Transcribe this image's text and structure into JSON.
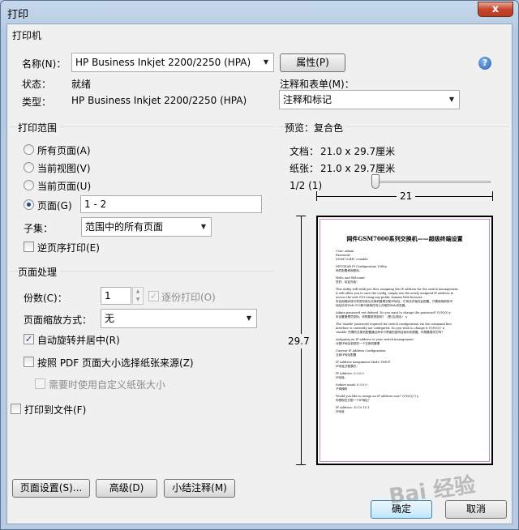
{
  "window": {
    "title": "打印",
    "close_label": "x"
  },
  "printer": {
    "section_title": "打印机",
    "name_label": "名称(N)：",
    "name_value": "HP Business Inkjet 2200/2250 (HPA)",
    "properties_button": "属性(P)",
    "status_label": "状态：",
    "status_value": "就绪",
    "type_label": "类型：",
    "type_value": "HP Business Inkjet 2200/2250 (HPA)",
    "comments_label": "注释和表单(M)：",
    "comments_value": "注释和标记",
    "help_icon": "?"
  },
  "print_range": {
    "section_title": "打印范围",
    "options": [
      {
        "label": "所有页面(A)",
        "selected": false
      },
      {
        "label": "当前视图(V)",
        "selected": false
      },
      {
        "label": "当前页面(U)",
        "selected": false
      },
      {
        "label": "页面(G)",
        "selected": true
      }
    ],
    "pages_value": "1 - 2",
    "subset_label": "子集：",
    "subset_value": "范围中的所有页面",
    "reverse_label": "逆页序打印(E)",
    "reverse_checked": false
  },
  "page_handling": {
    "section_title": "页面处理",
    "copies_label": "份数(C)：",
    "copies_value": "1",
    "collate_label": "逐份打印(O)",
    "collate_checked": true,
    "scaling_label": "页面缩放方式：",
    "scaling_value": "无",
    "auto_rotate_label": "自动旋转并居中(R)",
    "auto_rotate_checked": true,
    "pdf_paper_label": "按照 PDF 页面大小选择纸张来源(Z)",
    "pdf_paper_checked": false,
    "custom_paper_label": "需要时使用自定义纸张大小",
    "custom_paper_checked": false
  },
  "print_to_file_label": "打印到文件(F)",
  "print_to_file_checked": false,
  "preview": {
    "section_title": "预览：复合色",
    "document_label": "文档：",
    "document_size": "21.0 x 29.7厘米",
    "paper_label": "纸张：",
    "paper_size": "21.0 x 29.7厘米",
    "page_counter": "1/2 (1)",
    "slider_value": 0.0,
    "width_dim": "21",
    "height_dim": "29.7",
    "doc_title": "网件GSM7000系列交换机——超级终端设置",
    "doc_lines": [
      "User: admin",
      "Password:",
      "(GSM7224P) >enable",
      "",
      "NETGEAR FI Configuration Utility",
      "网件配置使用程序。",
      "",
      "Hello and Welcome!",
      "您好，欢迎光临！",
      "",
      "This utility will walk you thru assigning the IP address for the switch management.",
      "It will allow you to save the config, simply use the newly assigned IP address to",
      "access the web GUI using any public domain Web browser.",
      "本实用程序将引导您完成为交换机管理分配IP地址，它将允许保存此配置。只需使用新的IP",
      "地址访问Web GUI即可使用任何公共域的Web浏览器。",
      "",
      "Admin password not defined. Do you want to change the password? (Y/N/Q) y",
      "未设置管理员密码。你想要更改密码？（是/否/退出） y",
      "",
      "The 'enable' password required for switch configuration via the command line",
      "interface is currently not configured. Do you wish to change it (Y/N/Q)? n",
      "'enable' 所需的交换机配置通过命令行界面的密码目前尚未配置。你想要更改它吗？",
      "",
      "Assigning an IP address to your switch management",
      "分配IP地址到您的一个交换机管理",
      "",
      "Current IP Address Configuration",
      "当前IP地址配置",
      "",
      "IP Address Assignment Mode: DHCP",
      "IP地址分配模式：",
      "",
      "IP Address: 0.0.0.0",
      "IP地址：",
      "",
      "Subnet mask: 0.0.0.0",
      "子网掩码",
      "",
      "Would you like to assign an IP address now? (Y/N/Q/?) y",
      "你想现在分配一个IP地址？",
      "",
      "IP Address: 10.10.10.1",
      "IP地址"
    ]
  },
  "buttons": {
    "page_setup": "页面设置(S)...",
    "advanced": "高级(D)",
    "summarize": "小结注释(M)",
    "ok": "确定",
    "cancel": "取消"
  },
  "watermark_text": "Bai 经验"
}
